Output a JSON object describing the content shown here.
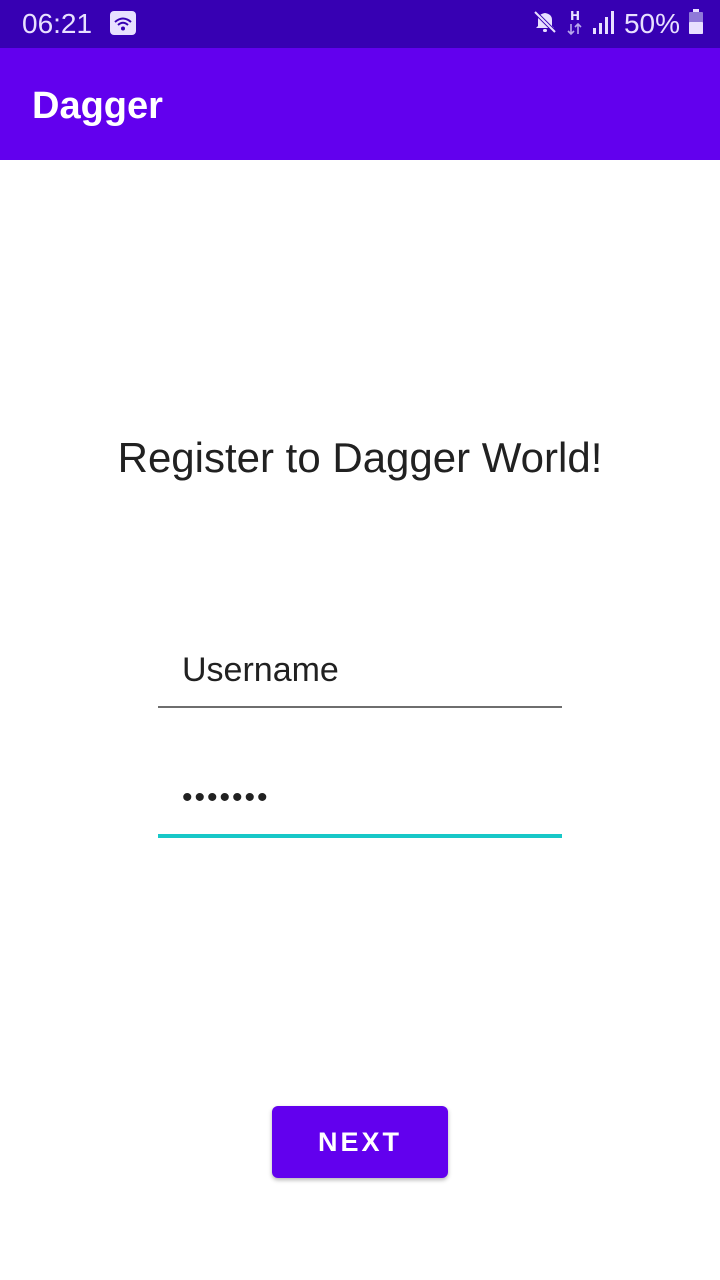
{
  "status_bar": {
    "time": "06:21",
    "battery_text": "50%",
    "icons": [
      "wifi-icon",
      "mute-icon",
      "network-h-icon",
      "signal-icon",
      "battery-icon"
    ]
  },
  "app_bar": {
    "title": "Dagger"
  },
  "main": {
    "heading": "Register to Dagger World!",
    "username_field": {
      "placeholder": "Username",
      "value": ""
    },
    "password_field": {
      "value": "•••••••"
    },
    "next_label": "NEXT"
  },
  "colors": {
    "status_bar": "#3700b3",
    "primary": "#6200ee",
    "focused_underline": "#17c8c8"
  }
}
